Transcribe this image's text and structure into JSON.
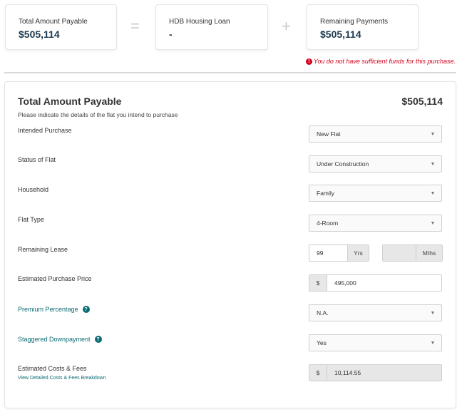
{
  "summary": {
    "total": {
      "label": "Total Amount Payable",
      "value": "$505,114"
    },
    "equals": "=",
    "loan": {
      "label": "HDB Housing Loan",
      "value": "-"
    },
    "plus": "+",
    "remaining": {
      "label": "Remaining Payments",
      "value": "$505,114"
    }
  },
  "warning": {
    "icon": "exclamation-icon",
    "glyph": "!",
    "text": "You do not have sufficient funds for this purchase."
  },
  "panel": {
    "title": "Total Amount Payable",
    "amount": "$505,114",
    "subtitle": "Please indicate the details of the flat you intend to purchase"
  },
  "form": {
    "intended_purchase": {
      "label": "Intended Purchase",
      "value": "New Flat"
    },
    "status": {
      "label": "Status of Flat",
      "value": "Under Construction"
    },
    "household": {
      "label": "Household",
      "value": "Family"
    },
    "flat_type": {
      "label": "Flat Type",
      "value": "4-Room"
    },
    "lease": {
      "label": "Remaining Lease",
      "years": "99",
      "years_unit": "Yrs",
      "months": "",
      "months_unit": "Mths"
    },
    "price": {
      "label": "Estimated Purchase Price",
      "currency": "$",
      "value": "495,000"
    },
    "premium": {
      "label": "Premium Percentage",
      "value": "N.A.",
      "help": "?"
    },
    "staggered": {
      "label": "Staggered Downpayment",
      "value": "Yes",
      "help": "?"
    },
    "costs": {
      "label": "Estimated Costs & Fees",
      "link": "View Detailed Costs & Fees Breakdown",
      "currency": "$",
      "value": "10,114.55"
    }
  },
  "caret": "▼",
  "colors": {
    "brand_dark": "#1e3a4f",
    "link": "#0b6b73",
    "error": "#d0021b"
  }
}
